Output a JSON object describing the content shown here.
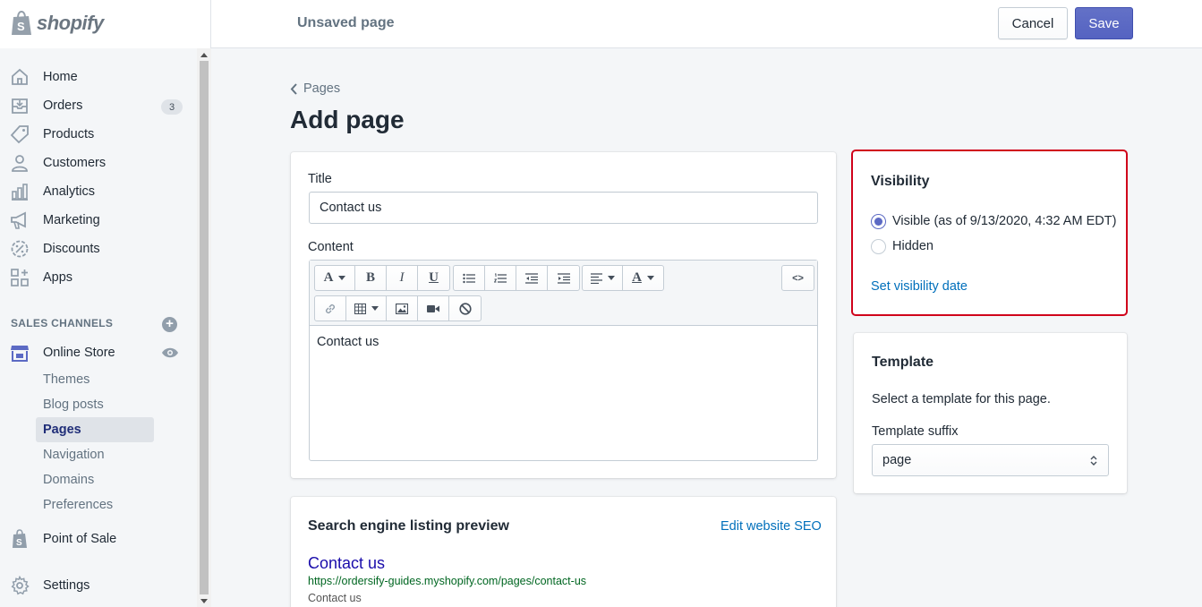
{
  "app": {
    "logo_text": "shopify"
  },
  "topbar": {
    "status": "Unsaved page",
    "cancel_label": "Cancel",
    "save_label": "Save"
  },
  "sidebar": {
    "items": [
      {
        "label": "Home",
        "icon": "home-icon"
      },
      {
        "label": "Orders",
        "icon": "orders-icon",
        "badge": "3"
      },
      {
        "label": "Products",
        "icon": "tag-icon"
      },
      {
        "label": "Customers",
        "icon": "person-icon"
      },
      {
        "label": "Analytics",
        "icon": "bar-chart-icon"
      },
      {
        "label": "Marketing",
        "icon": "megaphone-icon"
      },
      {
        "label": "Discounts",
        "icon": "discount-icon"
      },
      {
        "label": "Apps",
        "icon": "apps-icon"
      }
    ],
    "sales_channels_heading": "SALES CHANNELS",
    "online_store": {
      "label": "Online Store",
      "sub_items": [
        "Themes",
        "Blog posts",
        "Pages",
        "Navigation",
        "Domains",
        "Preferences"
      ],
      "active": "Pages"
    },
    "point_of_sale": "Point of Sale",
    "settings": "Settings"
  },
  "main": {
    "breadcrumb": "Pages",
    "title": "Add page",
    "form": {
      "title_label": "Title",
      "title_value": "Contact us",
      "content_label": "Content",
      "content_value": "Contact us",
      "html_toggle": "<>"
    },
    "seo": {
      "heading": "Search engine listing preview",
      "edit_link": "Edit website SEO",
      "preview_title": "Contact us",
      "preview_url": "https://ordersify-guides.myshopify.com/pages/contact-us",
      "preview_desc": "Contact us"
    }
  },
  "visibility": {
    "heading": "Visibility",
    "options": [
      {
        "label": "Visible (as of 9/13/2020, 4:32 AM EDT)",
        "checked": true
      },
      {
        "label": "Hidden",
        "checked": false
      }
    ],
    "set_date_link": "Set visibility date"
  },
  "template": {
    "heading": "Template",
    "description": "Select a template for this page.",
    "suffix_label": "Template suffix",
    "suffix_value": "page"
  },
  "colors": {
    "accent": "#5c6ac4",
    "link": "#006fbb",
    "highlight": "#d0021b"
  }
}
